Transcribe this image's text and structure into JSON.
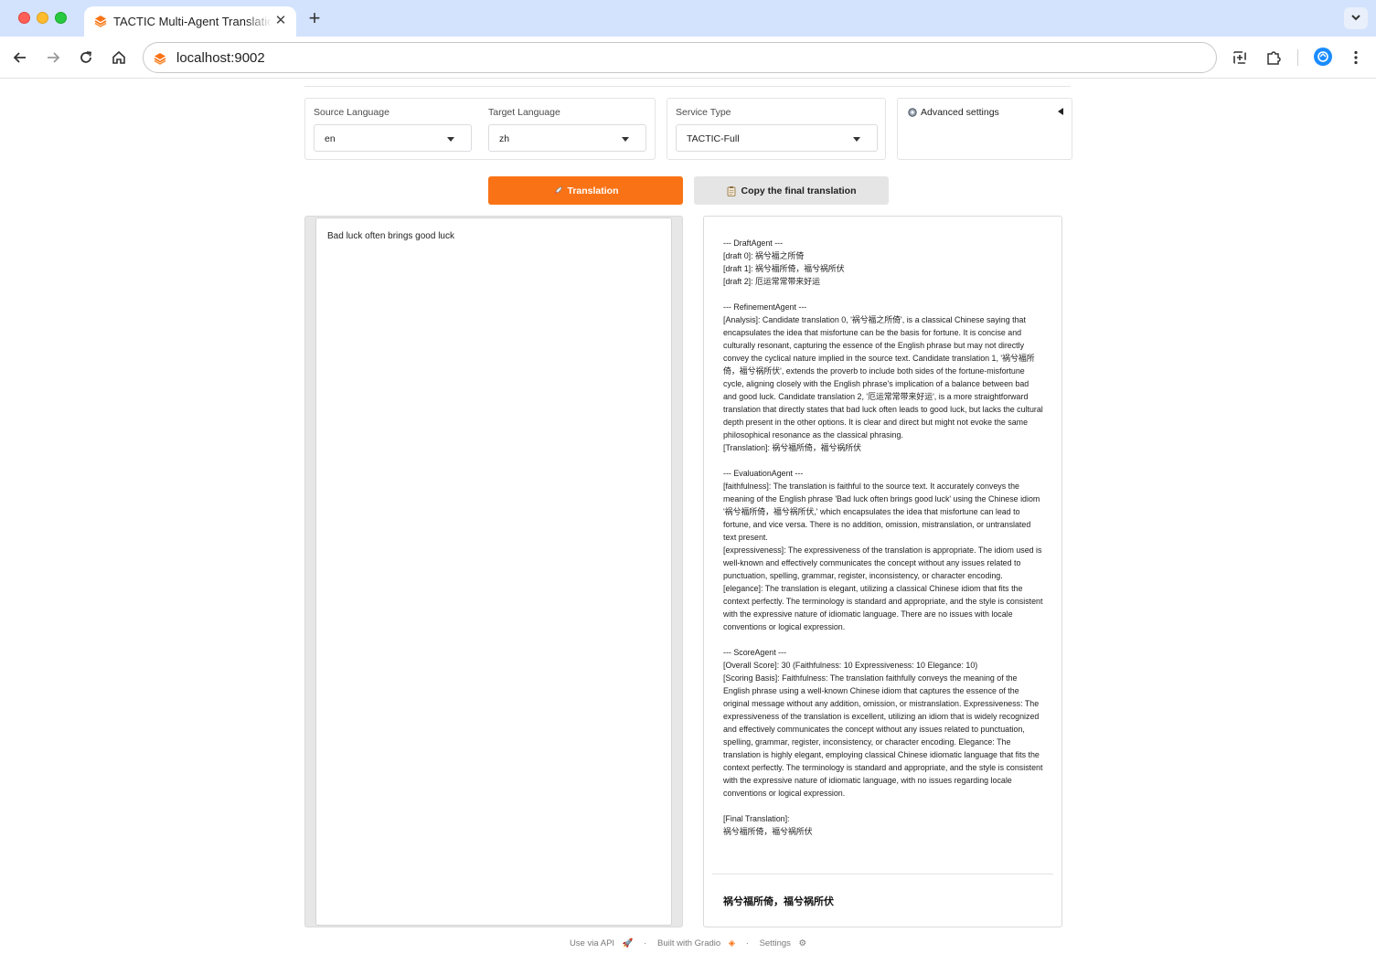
{
  "browser": {
    "tab_title": "TACTIC Multi-Agent Translation",
    "url": "localhost:9002",
    "new_tab_symbol": "+",
    "tab_close_symbol": "✕"
  },
  "controls": {
    "source_language_label": "Source Language",
    "source_language_value": "en",
    "target_language_label": "Target Language",
    "target_language_value": "zh",
    "service_type_label": "Service Type",
    "service_type_value": "TACTIC-Full",
    "advanced_settings_label": "Advanced settings"
  },
  "buttons": {
    "translate_label": "Translation",
    "copy_label": "Copy the final translation"
  },
  "input": {
    "text": "Bad luck often brings good luck"
  },
  "output": {
    "draft_header": "--- DraftAgent ---",
    "draft_0": "[draft 0]: 祸兮福之所倚",
    "draft_1": "[draft 1]: 祸兮福所倚，福兮祸所伏",
    "draft_2": "[draft 2]: 厄运常常带来好运",
    "refinement_header": "--- RefinementAgent ---",
    "analysis": "[Analysis]: Candidate translation 0, '祸兮福之所倚', is a classical Chinese saying that encapsulates the idea that misfortune can be the basis for fortune. It is concise and culturally resonant, capturing the essence of the English phrase but may not directly convey the cyclical nature implied in the source text. Candidate translation 1, '祸兮福所倚，福兮祸所伏', extends the proverb to include both sides of the fortune-misfortune cycle, aligning closely with the English phrase's implication of a balance between bad and good luck. Candidate translation 2, '厄运常常带来好运', is a more straightforward translation that directly states that bad luck often leads to good luck, but lacks the cultural depth present in the other options. It is clear and direct but might not evoke the same philosophical resonance as the classical phrasing.",
    "refined_translation": "[Translation]: 祸兮福所倚，福兮祸所伏",
    "evaluation_header": "--- EvaluationAgent ---",
    "faithfulness": "[faithfulness]: The translation is faithful to the source text. It accurately conveys the meaning of the English phrase 'Bad luck often brings good luck' using the Chinese idiom '祸兮福所倚，福兮祸所伏,' which encapsulates the idea that misfortune can lead to fortune, and vice versa. There is no addition, omission, mistranslation, or untranslated text present.",
    "expressiveness": "[expressiveness]: The expressiveness of the translation is appropriate. The idiom used is well-known and effectively communicates the concept without any issues related to punctuation, spelling, grammar, register, inconsistency, or character encoding.",
    "elegance": "[elegance]: The translation is elegant, utilizing a classical Chinese idiom that fits the context perfectly. The terminology is standard and appropriate, and the style is consistent with the expressive nature of idiomatic language. There are no issues with locale conventions or logical expression.",
    "score_header": "--- ScoreAgent ---",
    "overall_score": "[Overall Score]: 30 (Faithfulness: 10 Expressiveness: 10 Elegance: 10)",
    "scoring_basis": "[Scoring Basis]: Faithfulness: The translation faithfully conveys the meaning of the English phrase using a well-known Chinese idiom that captures the essence of the original message without any addition, omission, or mistranslation. Expressiveness: The expressiveness of the translation is excellent, utilizing an idiom that is widely recognized and effectively communicates the concept without any issues related to punctuation, spelling, grammar, register, inconsistency, or character encoding. Elegance: The translation is highly elegant, employing classical Chinese idiomatic language that fits the context perfectly. The terminology is standard and appropriate, and the style is consistent with the expressive nature of idiomatic language, with no issues regarding locale conventions or logical expression.",
    "final_label": "[Final Translation]:",
    "final_text": "祸兮福所倚，福兮祸所伏",
    "final_display": "祸兮福所倚，福兮祸所伏"
  },
  "footer": {
    "api": "Use via API",
    "sep": "·",
    "built": "Built with Gradio",
    "settings": "Settings"
  },
  "colors": {
    "primary_button": "#f97316",
    "secondary_button": "#e5e5e5",
    "tabstrip": "#d3e3fd"
  }
}
